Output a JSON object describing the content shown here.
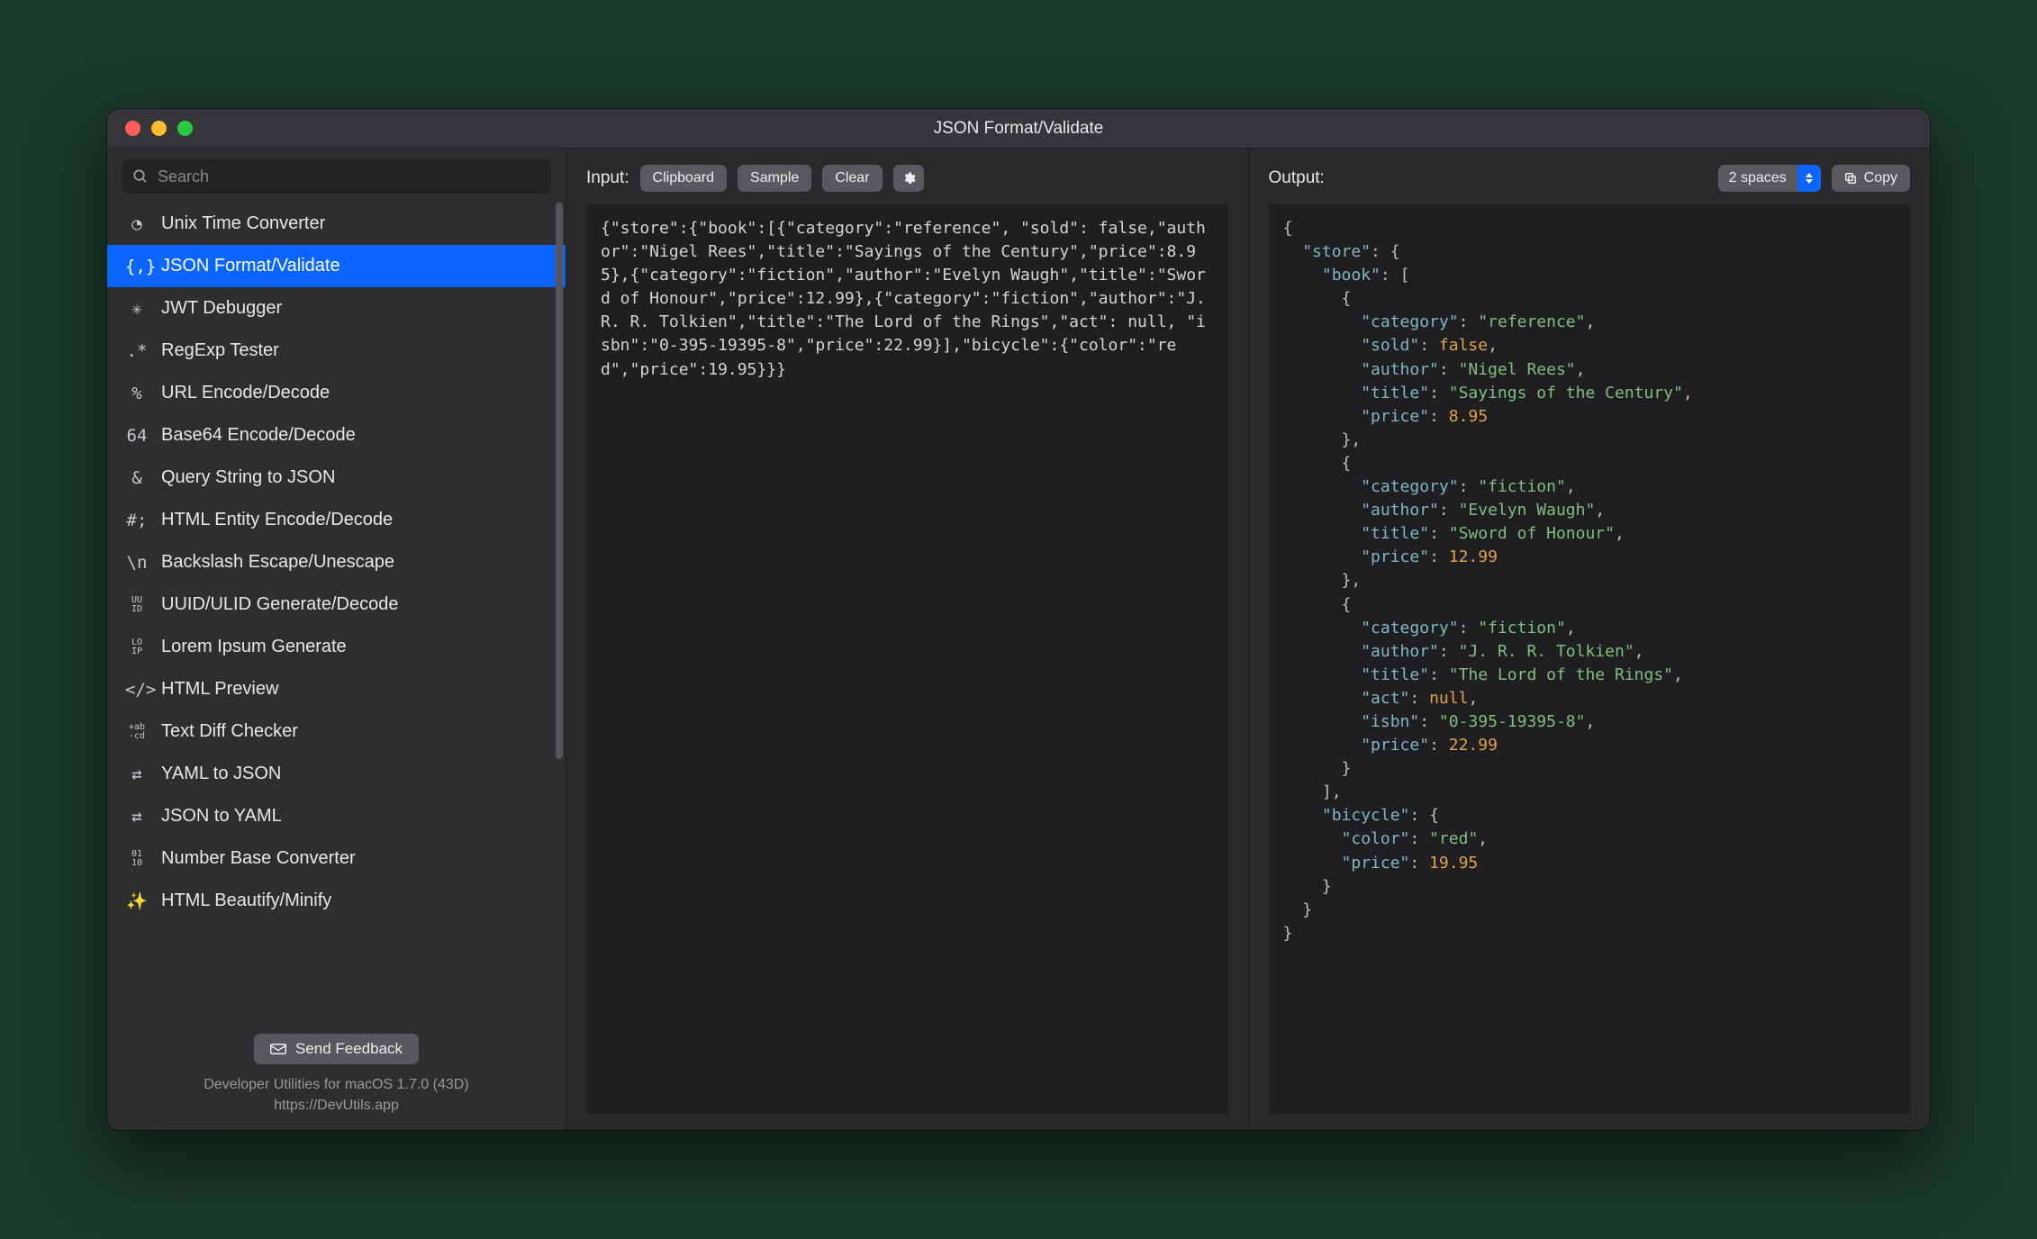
{
  "window": {
    "title": "JSON Format/Validate"
  },
  "search": {
    "placeholder": "Search"
  },
  "sidebar": {
    "selected_index": 1,
    "items": [
      {
        "icon": "clock",
        "label": "Unix Time Converter"
      },
      {
        "icon": "braces",
        "label": "JSON Format/Validate"
      },
      {
        "icon": "jwt",
        "label": "JWT Debugger"
      },
      {
        "icon": "regex",
        "label": "RegExp Tester"
      },
      {
        "icon": "pct",
        "label": "URL Encode/Decode"
      },
      {
        "icon": "b64",
        "label": "Base64 Encode/Decode"
      },
      {
        "icon": "amp",
        "label": "Query String to JSON"
      },
      {
        "icon": "hash",
        "label": "HTML Entity Encode/Decode"
      },
      {
        "icon": "bslash",
        "label": "Backslash Escape/Unescape"
      },
      {
        "icon": "uuid",
        "label": "UUID/ULID Generate/Decode"
      },
      {
        "icon": "lorem",
        "label": "Lorem Ipsum Generate"
      },
      {
        "icon": "tags",
        "label": "HTML Preview"
      },
      {
        "icon": "diff",
        "label": "Text Diff Checker"
      },
      {
        "icon": "swap",
        "label": "YAML to JSON"
      },
      {
        "icon": "swap",
        "label": "JSON to YAML"
      },
      {
        "icon": "bits",
        "label": "Number Base Converter"
      },
      {
        "icon": "wand",
        "label": "HTML Beautify/Minify"
      }
    ],
    "feedback_label": "Send Feedback",
    "footer_line1": "Developer Utilities for macOS 1.7.0 (43D)",
    "footer_line2": "https://DevUtils.app"
  },
  "input_pane": {
    "label": "Input:",
    "buttons": {
      "clipboard": "Clipboard",
      "sample": "Sample",
      "clear": "Clear"
    },
    "text": "{\"store\":{\"book\":[{\"category\":\"reference\", \"sold\": false,\"author\":\"Nigel Rees\",\"title\":\"Sayings of the Century\",\"price\":8.95},{\"category\":\"fiction\",\"author\":\"Evelyn Waugh\",\"title\":\"Sword of Honour\",\"price\":12.99},{\"category\":\"fiction\",\"author\":\"J. R. R. Tolkien\",\"title\":\"The Lord of the Rings\",\"act\": null, \"isbn\":\"0-395-19395-8\",\"price\":22.99}],\"bicycle\":{\"color\":\"red\",\"price\":19.95}}}"
  },
  "output_pane": {
    "label": "Output:",
    "indent_label": "2 spaces",
    "copy_label": "Copy",
    "json": {
      "store": {
        "book": [
          {
            "category": "reference",
            "sold": false,
            "author": "Nigel Rees",
            "title": "Sayings of the Century",
            "price": 8.95
          },
          {
            "category": "fiction",
            "author": "Evelyn Waugh",
            "title": "Sword of Honour",
            "price": 12.99
          },
          {
            "category": "fiction",
            "author": "J. R. R. Tolkien",
            "title": "The Lord of the Rings",
            "act": null,
            "isbn": "0-395-19395-8",
            "price": 22.99
          }
        ],
        "bicycle": {
          "color": "red",
          "price": 19.95
        }
      }
    }
  },
  "icons": {
    "clock": "◔",
    "braces": "{,}",
    "jwt": "✳",
    "regex": ".*",
    "pct": "%",
    "b64": "64",
    "amp": "&",
    "hash": "#;",
    "bslash": "\\n",
    "uuid": "UU\nID",
    "lorem": "LO\nIP",
    "tags": "</>",
    "diff": "+ab\n-cd",
    "swap": "⇄",
    "bits": "01\n10",
    "wand": "✨"
  }
}
